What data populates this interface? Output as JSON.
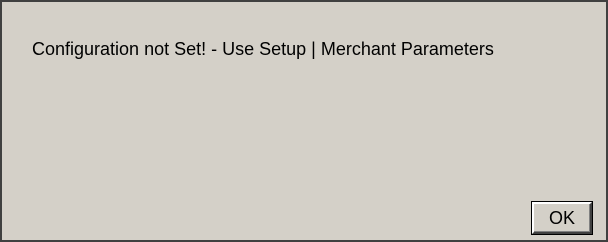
{
  "dialog": {
    "message": "Configuration not Set! - Use Setup | Merchant Parameters",
    "ok_label": "OK"
  },
  "colors": {
    "dialog_background": "#d4d0c8",
    "text": "#000000"
  }
}
